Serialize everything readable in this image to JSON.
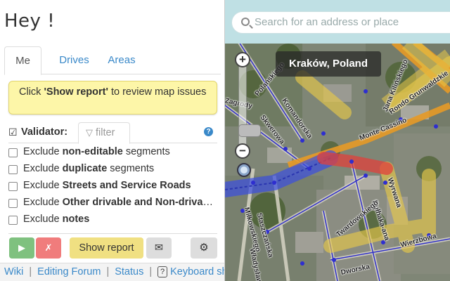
{
  "user": {
    "greeting": "Hey !"
  },
  "tabs": [
    {
      "label": "Me",
      "active": true
    },
    {
      "label": "Drives",
      "active": false
    },
    {
      "label": "Areas",
      "active": false
    }
  ],
  "notice": {
    "prefix": "Click ",
    "bold": "'Show report'",
    "suffix": " to review map issues"
  },
  "validator": {
    "label": "Validator:",
    "filter_label": "filter",
    "checked": true,
    "help": "?"
  },
  "options": [
    {
      "pre": "Exclude ",
      "bold": "non-editable",
      "post": " segments"
    },
    {
      "pre": "Exclude ",
      "bold": "duplicate",
      "post": " segments"
    },
    {
      "pre": "Exclude ",
      "bold": "Streets and Service Roads",
      "post": ""
    },
    {
      "pre": "Exclude ",
      "bold": "Other drivable and Non-drivable",
      "post": ""
    },
    {
      "pre": "Exclude ",
      "bold": "notes",
      "post": ""
    }
  ],
  "buttons": {
    "play": "▶",
    "stop": "✗",
    "report": "Show report",
    "mail": "✉",
    "settings": "⚙"
  },
  "footer": {
    "wiki": "Wiki",
    "forum": "Editing Forum",
    "status": "Status",
    "keyboard": "Keyboard shortcuts",
    "kb_icon": "?"
  },
  "map": {
    "search_placeholder": "Search for an address or place",
    "city": "Kraków, Poland",
    "zoom_in": "+",
    "zoom_out": "−",
    "streets": [
      {
        "name": "Rondo Grunwaldzkie"
      },
      {
        "name": "Monte Cassino"
      },
      {
        "name": "Jana Kilińskiego"
      },
      {
        "name": "Komandorska"
      },
      {
        "name": "Skwerowa"
      },
      {
        "name": "Polańskiego"
      },
      {
        "name": "Zagrody"
      },
      {
        "name": "Wyrwana"
      },
      {
        "name": "Bułhaka-ana"
      },
      {
        "name": "Wierzbowa"
      },
      {
        "name": "Twardowskiego"
      },
      {
        "name": "Miłkowskiego"
      },
      {
        "name": "Staszczańska"
      },
      {
        "name": "Władysława"
      },
      {
        "name": "Dworska"
      }
    ]
  }
}
